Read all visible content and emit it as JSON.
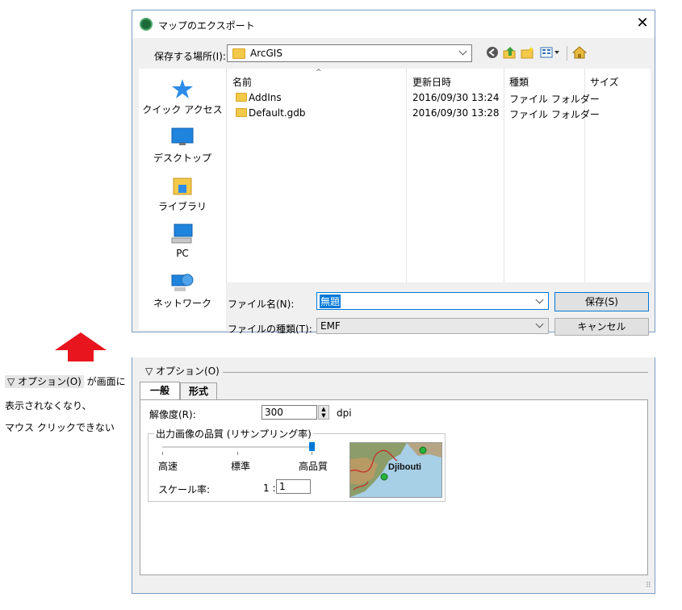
{
  "dialog": {
    "title": "マップのエクスポート",
    "close_glyph": "✕",
    "location_label": "保存する場所(I):",
    "location_value": "ArcGIS",
    "nav": [
      "クイック アクセス",
      "デスクトップ",
      "ライブラリ",
      "PC",
      "ネットワーク"
    ],
    "columns": [
      "名前",
      "更新日時",
      "種類",
      "サイズ"
    ],
    "files": [
      {
        "name": "AddIns",
        "date": "2016/09/30 13:24",
        "type": "ファイル フォルダー"
      },
      {
        "name": "Default.gdb",
        "date": "2016/09/30 13:28",
        "type": "ファイル フォルダー"
      }
    ],
    "filename_label": "ファイル名(N):",
    "filename_value": "無題",
    "filetype_label": "ファイルの種類(T):",
    "filetype_value": "EMF",
    "save_button": "保存(S)",
    "cancel_button": "キャンセル"
  },
  "note": {
    "option_chip": "▽ オプション(O)",
    "line1_rest": " が画面に",
    "line2": "表示されなくなり、",
    "line3": "マウス クリックできない"
  },
  "panel": {
    "options_header": "▽ オプション(O)",
    "tabs": [
      "一般",
      "形式"
    ],
    "resolution_label": "解像度(R):",
    "resolution_value": "300",
    "resolution_unit": "dpi",
    "quality_group": "出力画像の品質 (リサンプリング率)",
    "quality_low": "高速",
    "quality_mid": "標準",
    "quality_high": "高品質",
    "quality_level": 1.0,
    "scale_label": "スケール率:",
    "scale_prefix": "1 :",
    "scale_value": "1",
    "map_label": "Djibouti"
  },
  "colors": {
    "accent": "#0078d7",
    "arrow": "#e8141e",
    "folder": "#f3c94a"
  }
}
